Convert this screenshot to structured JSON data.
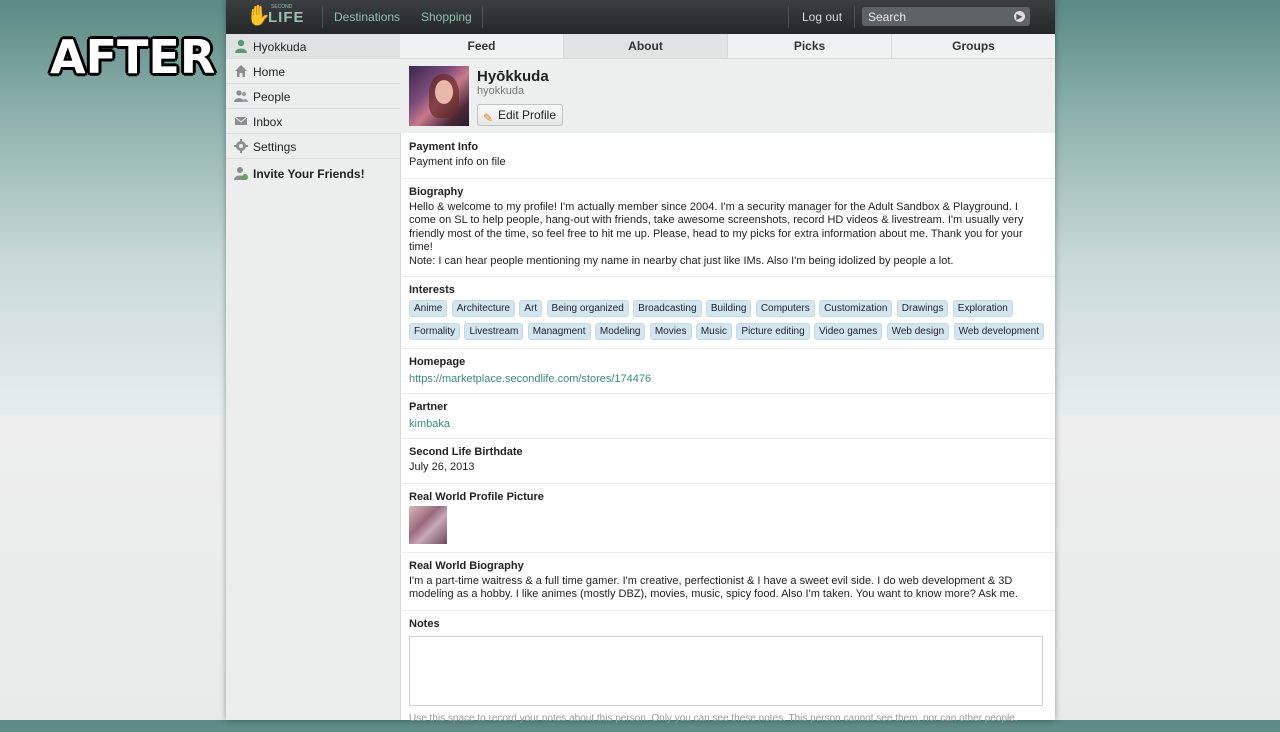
{
  "overlay_label": "AFTER",
  "header": {
    "logo_small": "SECOND",
    "logo_text": "LIFE",
    "nav": [
      "Destinations",
      "Shopping"
    ],
    "logout": "Log out",
    "search_placeholder": "Search"
  },
  "sidebar": {
    "items": [
      {
        "label": "Hyokkuda",
        "icon": "user-icon"
      },
      {
        "label": "Home",
        "icon": "home-icon"
      },
      {
        "label": "People",
        "icon": "people-icon"
      },
      {
        "label": "Inbox",
        "icon": "envelope-icon"
      },
      {
        "label": "Settings",
        "icon": "gear-icon"
      }
    ],
    "invite": "Invite Your Friends!"
  },
  "tabs": [
    "Feed",
    "About",
    "Picks",
    "Groups"
  ],
  "active_tab": "About",
  "profile": {
    "display_name": "Hyōkkuda",
    "username": "hyokkuda",
    "edit_button": "Edit Profile"
  },
  "sections": {
    "payment": {
      "title": "Payment Info",
      "value": "Payment info on file"
    },
    "biography": {
      "title": "Biography",
      "text": "Hello & welcome to my profile! I'm actually member since 2004. I'm a security manager for the Adult Sandbox & Playground. I come on SL to help people, hang-out with friends, take awesome screenshots, record HD videos & livestream. I'm usually very friendly most of the time, so feel free to hit me up. Please, head to my picks for extra information about me. Thank you for your time!",
      "note": "Note: I can hear people mentioning my name in nearby chat just like IMs. Also I'm being idolized by people a lot."
    },
    "interests": {
      "title": "Interests",
      "tags": [
        "Anime",
        "Architecture",
        "Art",
        "Being organized",
        "Broadcasting",
        "Building",
        "Computers",
        "Customization",
        "Drawings",
        "Exploration",
        "Formality",
        "Livestream",
        "Managment",
        "Modeling",
        "Movies",
        "Music",
        "Picture editing",
        "Video games",
        "Web design",
        "Web development"
      ]
    },
    "homepage": {
      "title": "Homepage",
      "url": "https://marketplace.secondlife.com/stores/174476"
    },
    "partner": {
      "title": "Partner",
      "name": "kimbaka"
    },
    "birthdate": {
      "title": "Second Life Birthdate",
      "value": "July 26, 2013"
    },
    "rw_picture": {
      "title": "Real World Profile Picture"
    },
    "rw_bio": {
      "title": "Real World Biography",
      "text": "I'm a part-time waitress & a full time gamer. I'm creative, perfectionist & I have a sweet evil side. I do web development & 3D modeling as a hobby. I like animes (mostly DBZ), movies, music, spicy food. Also I'm taken. You want to know more? Ask me."
    },
    "notes": {
      "title": "Notes",
      "hint": "Use this space to record your notes about this person. Only you can see these notes. This person cannot see them, nor can other people."
    }
  },
  "colors": {
    "accent_link": "#3a8a7a",
    "tag_bg": "#d3e6ef",
    "topbar": "#2c3032"
  }
}
